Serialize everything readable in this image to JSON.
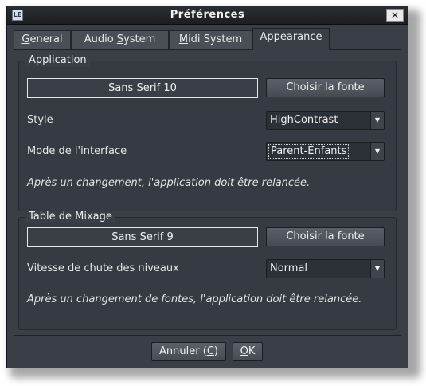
{
  "window": {
    "title": "Préférences",
    "app_icon_glyph": "LE",
    "close_glyph": "✕"
  },
  "tabs": [
    {
      "pre": "",
      "mnemonic": "G",
      "post": "eneral"
    },
    {
      "pre": "Audio ",
      "mnemonic": "S",
      "post": "ystem"
    },
    {
      "pre": "",
      "mnemonic": "M",
      "post": "idi System"
    },
    {
      "pre": "",
      "mnemonic": "A",
      "post": "ppearance"
    }
  ],
  "active_tab": "Appearance",
  "application": {
    "legend": "Application",
    "font_value": "Sans Serif  10",
    "choose_font_label": "Choisir la fonte",
    "style_label": "Style",
    "style_value": "HighContrast",
    "interface_label": "Mode de l'interface",
    "interface_value": "Parent-Enfants",
    "note": "Après un changement, l'application doit être relancée."
  },
  "mixer": {
    "legend": "Table de Mixage",
    "font_value": "Sans Serif  9",
    "choose_font_label": "Choisir la fonte",
    "falloff_label": "Vitesse de chute des niveaux",
    "falloff_value": "Normal",
    "note": "Après un changement de fontes, l'application doit être relancée."
  },
  "footer": {
    "cancel_pre": "Annuler (",
    "cancel_mnemonic": "C",
    "cancel_post": ")",
    "ok_mnemonic": "O",
    "ok_post": "K"
  },
  "icons": {
    "dropdown_arrow": "▼"
  },
  "colors": {
    "window_bg": "#3a3f47",
    "titlebar_bg": "#1c1e21",
    "text": "#e8e8e8"
  }
}
